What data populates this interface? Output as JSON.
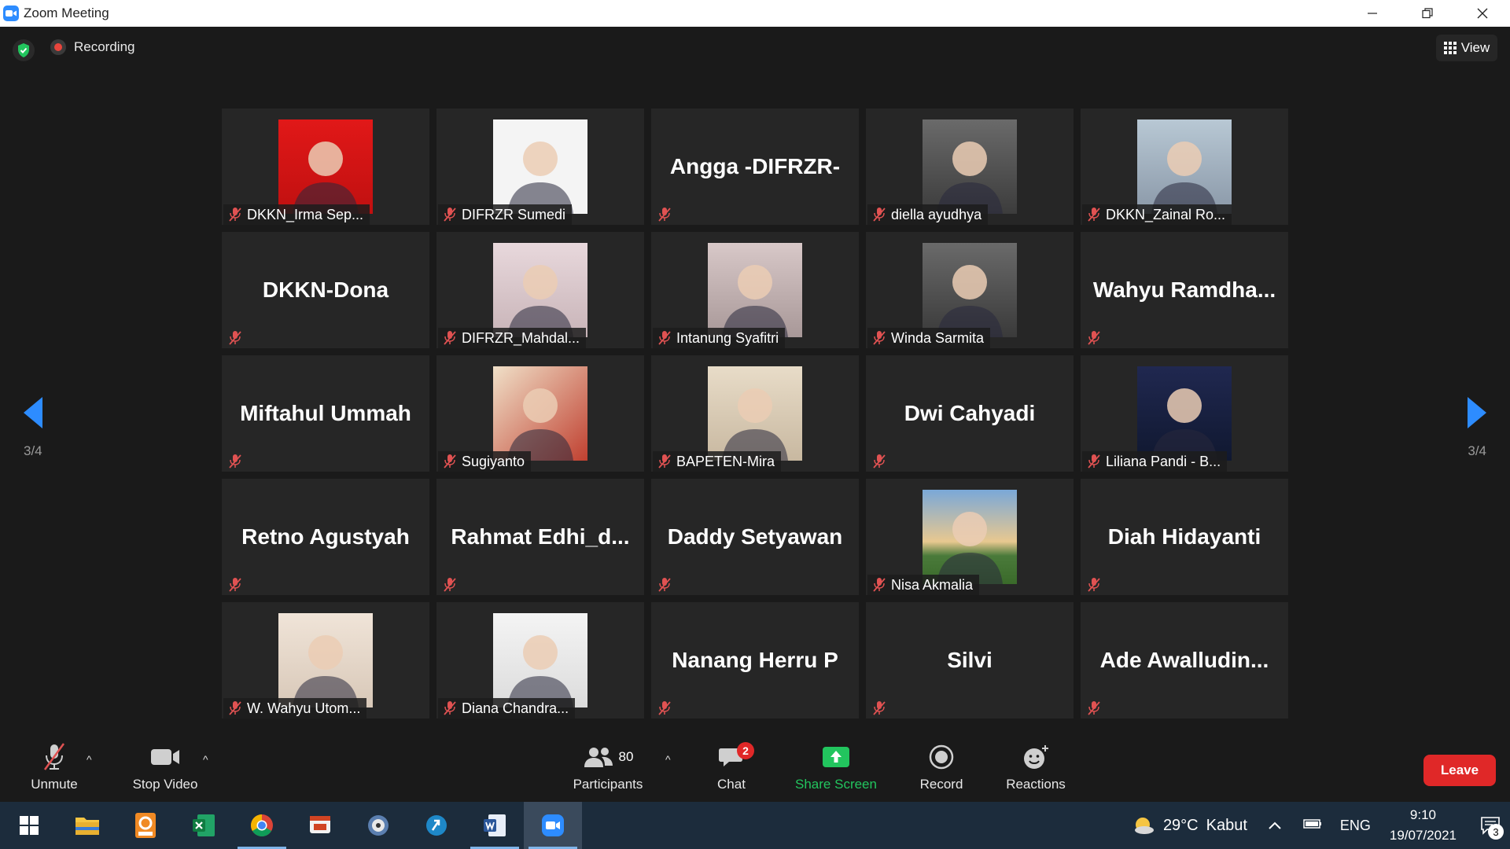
{
  "window": {
    "title": "Zoom Meeting"
  },
  "top": {
    "recording_label": "Recording",
    "view_label": "View"
  },
  "pager": {
    "left_label": "3/4",
    "right_label": "3/4"
  },
  "participants": [
    {
      "name": "DKKN_Irma Sep...",
      "has_video": true
    },
    {
      "name": "DIFRZR Sumedi",
      "has_video": true
    },
    {
      "big_name": "Angga -DIFRZR-",
      "has_video": false
    },
    {
      "name": "diella ayudhya",
      "has_video": true
    },
    {
      "name": "DKKN_Zainal Ro...",
      "has_video": true
    },
    {
      "big_name": "DKKN-Dona",
      "has_video": false
    },
    {
      "name": "DIFRZR_Mahdal...",
      "has_video": true
    },
    {
      "name": "Intanung Syafitri",
      "has_video": true
    },
    {
      "name": "Winda Sarmita",
      "has_video": true
    },
    {
      "big_name": "Wahyu  Ramdha...",
      "has_video": false
    },
    {
      "big_name": "Miftahul Ummah",
      "has_video": false
    },
    {
      "name": "Sugiyanto",
      "has_video": true
    },
    {
      "name": "BAPETEN-Mira",
      "has_video": true
    },
    {
      "big_name": "Dwi Cahyadi",
      "has_video": false
    },
    {
      "name": "Liliana Pandi - B...",
      "has_video": true
    },
    {
      "big_name": "Retno Agustyah",
      "has_video": false
    },
    {
      "big_name": "Rahmat  Edhi_d...",
      "has_video": false
    },
    {
      "big_name": "Daddy Setyawan",
      "has_video": false
    },
    {
      "name": "Nisa Akmalia",
      "has_video": true
    },
    {
      "big_name": "Diah Hidayanti",
      "has_video": false
    },
    {
      "name": "W. Wahyu Utom...",
      "has_video": true
    },
    {
      "name": "Diana Chandra...",
      "has_video": true
    },
    {
      "big_name": "Nanang Herru  P",
      "has_video": false
    },
    {
      "big_name": "Silvi",
      "has_video": false
    },
    {
      "big_name": "Ade  Awalludin...",
      "has_video": false
    }
  ],
  "toolbar": {
    "unmute": "Unmute",
    "stop_video": "Stop Video",
    "participants": "Participants",
    "participant_count": "80",
    "chat": "Chat",
    "chat_badge": "2",
    "share_screen": "Share Screen",
    "record": "Record",
    "reactions": "Reactions",
    "leave": "Leave"
  },
  "taskbar": {
    "apps": [
      "windows-start",
      "file-explorer",
      "pdf-app",
      "excel",
      "chrome",
      "powerpoint",
      "media-app",
      "sync-app",
      "word",
      "zoom"
    ],
    "weather": {
      "temp": "29°C",
      "text": "Kabut"
    },
    "language": "ENG",
    "time": "9:10",
    "date": "19/07/2021",
    "notifications": "3"
  },
  "colors": {
    "accent_blue": "#2d8cff",
    "share_green": "#22c55e",
    "leave_red": "#e02828",
    "mute_red": "#e05252",
    "nav_arrow": "#2d8cff"
  }
}
